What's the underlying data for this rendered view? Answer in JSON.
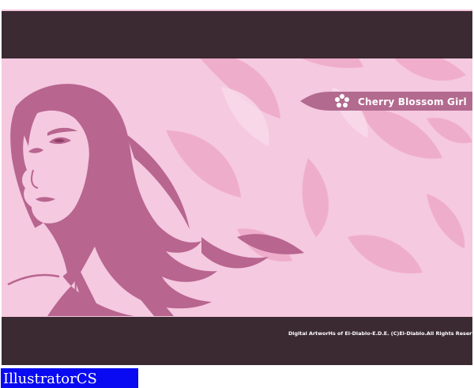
{
  "artwork": {
    "title": "Cherry Blossom Girl",
    "copyright": "Digital ArtworHs of El-Diablo-E.D.E. (C)El-Diablo.All Rights Reserved",
    "colors": {
      "background": "#f5c9e0",
      "bar": "#3b2a32",
      "figure": "#b8658f",
      "petal": "#eea4c6",
      "title_tab": "#b36a8f"
    }
  },
  "watermark_label": "IllustratorCS"
}
